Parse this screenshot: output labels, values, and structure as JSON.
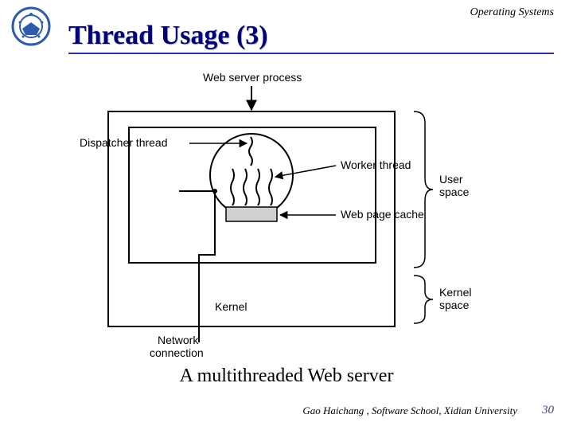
{
  "course": "Operating Systems",
  "title": "Thread Usage (3)",
  "caption": "A multithreaded Web server",
  "credit": "Gao Haichang , Software School, Xidian University",
  "page": "30",
  "fig": {
    "web_server_process": "Web server process",
    "dispatcher_thread": "Dispatcher thread",
    "worker_thread": "Worker thread",
    "web_page_cache": "Web page cache",
    "kernel": "Kernel",
    "network_connection": "Network\nconnection",
    "user_space": "User\nspace",
    "kernel_space": "Kernel\nspace"
  }
}
